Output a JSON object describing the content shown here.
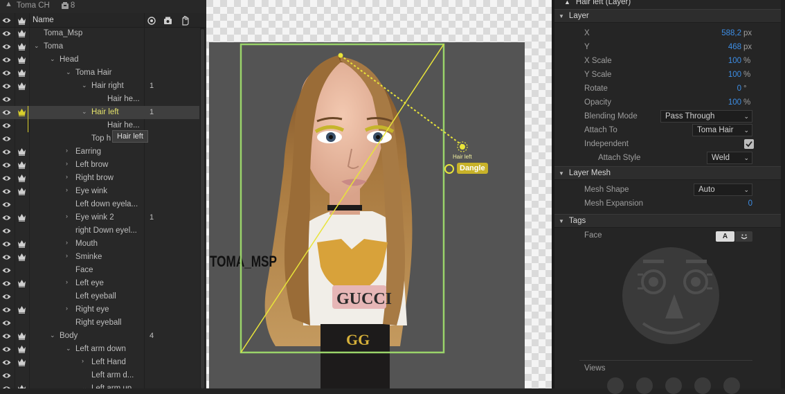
{
  "left_panel": {
    "app_name": "Toma CH",
    "layer_count": "8",
    "header_name": "Name",
    "tooltip": "Hair left",
    "rows": [
      {
        "label": "Toma_Msp",
        "depth": 0,
        "expander": "none",
        "crown": true,
        "eye": true,
        "num": ""
      },
      {
        "label": "Toma",
        "depth": 0,
        "expander": "down",
        "crown": true,
        "eye": true,
        "num": ""
      },
      {
        "label": "Head",
        "depth": 1,
        "expander": "down",
        "crown": true,
        "eye": true,
        "num": ""
      },
      {
        "label": "Toma Hair",
        "depth": 2,
        "expander": "down",
        "crown": true,
        "eye": true,
        "num": ""
      },
      {
        "label": "Hair right",
        "depth": 3,
        "expander": "down",
        "crown": true,
        "eye": true,
        "num": "1"
      },
      {
        "label": "Hair he...",
        "depth": 4,
        "expander": "none",
        "crown": false,
        "eye": true,
        "num": ""
      },
      {
        "label": "Hair left",
        "depth": 3,
        "expander": "down",
        "crown": true,
        "eye": true,
        "num": "1",
        "selected": true
      },
      {
        "label": "Hair he...",
        "depth": 4,
        "expander": "none",
        "crown": false,
        "eye": true,
        "num": ""
      },
      {
        "label": "Top h",
        "depth": 3,
        "expander": "none",
        "crown": false,
        "eye": true,
        "num": ""
      },
      {
        "label": "Earring",
        "depth": 2,
        "expander": "right",
        "crown": true,
        "eye": true,
        "num": ""
      },
      {
        "label": "Left brow",
        "depth": 2,
        "expander": "right",
        "crown": true,
        "eye": true,
        "num": ""
      },
      {
        "label": "Right brow",
        "depth": 2,
        "expander": "right",
        "crown": true,
        "eye": true,
        "num": ""
      },
      {
        "label": "Eye wink",
        "depth": 2,
        "expander": "right",
        "crown": true,
        "eye": true,
        "num": ""
      },
      {
        "label": "Left down eyela...",
        "depth": 2,
        "expander": "none",
        "crown": false,
        "eye": true,
        "num": ""
      },
      {
        "label": "Eye wink 2",
        "depth": 2,
        "expander": "right",
        "crown": true,
        "eye": true,
        "num": "1"
      },
      {
        "label": "right Down eyel...",
        "depth": 2,
        "expander": "none",
        "crown": false,
        "eye": true,
        "num": ""
      },
      {
        "label": "Mouth",
        "depth": 2,
        "expander": "right",
        "crown": true,
        "eye": true,
        "num": ""
      },
      {
        "label": "Sminke",
        "depth": 2,
        "expander": "right",
        "crown": true,
        "eye": true,
        "num": ""
      },
      {
        "label": "Face",
        "depth": 2,
        "expander": "none",
        "crown": false,
        "eye": true,
        "num": ""
      },
      {
        "label": "Left eye",
        "depth": 2,
        "expander": "right",
        "crown": true,
        "eye": true,
        "num": ""
      },
      {
        "label": "Left eyeball",
        "depth": 2,
        "expander": "none",
        "crown": false,
        "eye": true,
        "num": ""
      },
      {
        "label": "Right eye",
        "depth": 2,
        "expander": "right",
        "crown": true,
        "eye": true,
        "num": ""
      },
      {
        "label": "Right eyeball",
        "depth": 2,
        "expander": "none",
        "crown": false,
        "eye": true,
        "num": ""
      },
      {
        "label": "Body",
        "depth": 1,
        "expander": "down",
        "crown": true,
        "eye": true,
        "num": "4"
      },
      {
        "label": "Left arm down",
        "depth": 2,
        "expander": "down",
        "crown": true,
        "eye": true,
        "num": ""
      },
      {
        "label": "Left Hand",
        "depth": 3,
        "expander": "right",
        "crown": true,
        "eye": true,
        "num": ""
      },
      {
        "label": "Left arm d...",
        "depth": 3,
        "expander": "none",
        "crown": false,
        "eye": true,
        "num": ""
      },
      {
        "label": "Left arm up",
        "depth": 3,
        "expander": "down",
        "crown": true,
        "eye": true,
        "num": ""
      }
    ]
  },
  "canvas": {
    "handle_label": "Hair left",
    "dangle_label": "Dangle",
    "watermark": "TOMA_MSP",
    "shirt_text": "GUCCI"
  },
  "right_panel": {
    "title": "Hair left (Layer)",
    "layer_section": "Layer",
    "props": [
      {
        "label": "X",
        "value": "588,2",
        "unit": "px"
      },
      {
        "label": "Y",
        "value": "468",
        "unit": "px"
      },
      {
        "label": "X Scale",
        "value": "100",
        "unit": "%"
      },
      {
        "label": "Y Scale",
        "value": "100",
        "unit": "%"
      },
      {
        "label": "Rotate",
        "value": "0",
        "unit": "°"
      },
      {
        "label": "Opacity",
        "value": "100",
        "unit": "%"
      }
    ],
    "blending_label": "Blending Mode",
    "blending_value": "Pass Through",
    "attach_label": "Attach To",
    "attach_value": "Toma Hair",
    "independent_label": "Independent",
    "independent_checked": true,
    "attach_style_label": "Attach Style",
    "attach_style_value": "Weld",
    "mesh_section": "Layer Mesh",
    "mesh_shape_label": "Mesh Shape",
    "mesh_shape_value": "Auto",
    "mesh_expansion_label": "Mesh Expansion",
    "mesh_expansion_value": "0",
    "tags_section": "Tags",
    "face_label": "Face",
    "face_tab_a": "A",
    "views_label": "Views"
  },
  "colors": {
    "accent_value": "#3d8ee6",
    "selection_yellow": "#e8e43a",
    "bbox_green": "#9ad46a"
  }
}
